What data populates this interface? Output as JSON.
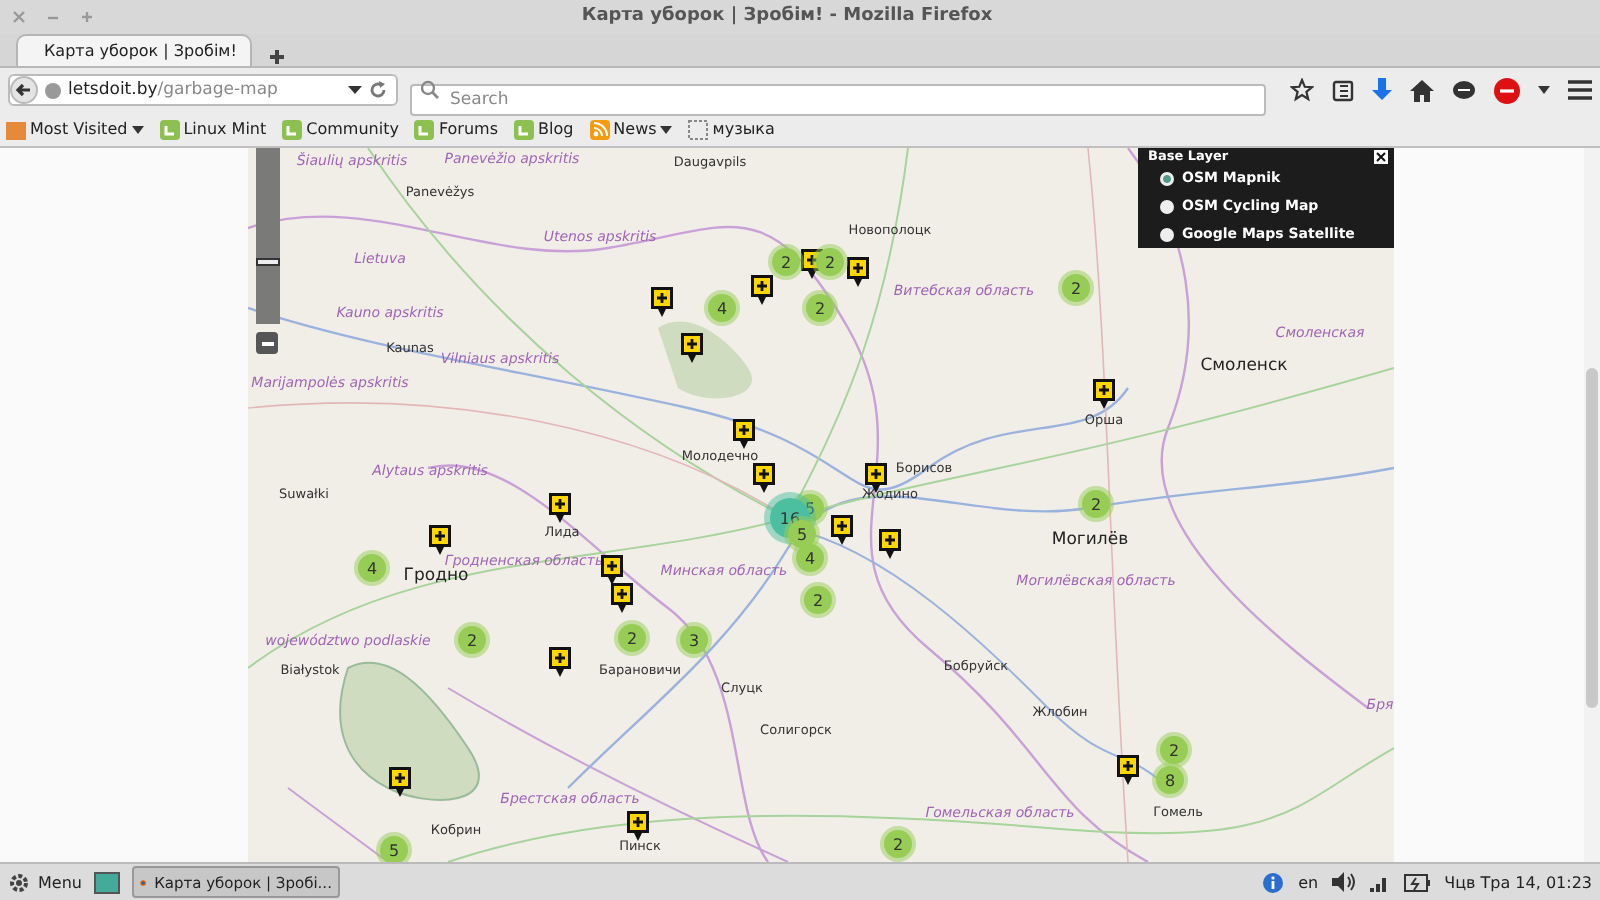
{
  "window": {
    "title": "Карта уборок | Зробім! - Mozilla Firefox"
  },
  "tabs": [
    {
      "label": "Карта уборок | Зробім!",
      "selected": true
    }
  ],
  "url": {
    "host": "letsdoit.by",
    "path": "/garbage-map"
  },
  "search": {
    "placeholder": "Search"
  },
  "bookmarks": [
    {
      "label": "Most Visited",
      "kind": "menu"
    },
    {
      "label": "Linux Mint",
      "kind": "page"
    },
    {
      "label": "Community",
      "kind": "page"
    },
    {
      "label": "Forums",
      "kind": "page"
    },
    {
      "label": "Blog",
      "kind": "page"
    },
    {
      "label": "News",
      "kind": "feed"
    },
    {
      "label": "музыка",
      "kind": "folder"
    }
  ],
  "map": {
    "zoom": {
      "level": 0.35
    },
    "layer_switcher": {
      "title": "Base Layer",
      "options": [
        {
          "label": "OSM Mapnik",
          "selected": true
        },
        {
          "label": "OSM Cycling Map",
          "selected": false
        },
        {
          "label": "Google Maps Satellite",
          "selected": false
        }
      ]
    },
    "labels": [
      {
        "text": "Šiaulių apskritis",
        "kind": "region"
      },
      {
        "text": "Panevėžio apskritis",
        "kind": "region"
      },
      {
        "text": "Daugavpils",
        "kind": "city"
      },
      {
        "text": "Panevėžys",
        "kind": "city"
      },
      {
        "text": "Utenos apskritis",
        "kind": "region"
      },
      {
        "text": "Новополоцк",
        "kind": "city"
      },
      {
        "text": "Lietuva",
        "kind": "region"
      },
      {
        "text": "Kauno apskritis",
        "kind": "region"
      },
      {
        "text": "Витебская область",
        "kind": "region"
      },
      {
        "text": "Kaunas",
        "kind": "city"
      },
      {
        "text": "Vilniaus apskritis",
        "kind": "region"
      },
      {
        "text": "Marijampolės apskritis",
        "kind": "region"
      },
      {
        "text": "Смоленская",
        "kind": "region"
      },
      {
        "text": "Смоленск",
        "kind": "capital"
      },
      {
        "text": "Молодечно",
        "kind": "city"
      },
      {
        "text": "Орша",
        "kind": "city"
      },
      {
        "text": "Alytaus apskritis",
        "kind": "region"
      },
      {
        "text": "Suwałki",
        "kind": "city"
      },
      {
        "text": "Борисов",
        "kind": "city"
      },
      {
        "text": "Жодино",
        "kind": "city"
      },
      {
        "text": "Лида",
        "kind": "city"
      },
      {
        "text": "Могилёв",
        "kind": "capital"
      },
      {
        "text": "Гродно",
        "kind": "capital"
      },
      {
        "text": "Гродненская область",
        "kind": "region"
      },
      {
        "text": "Минская область",
        "kind": "region"
      },
      {
        "text": "Могилёвская область",
        "kind": "region"
      },
      {
        "text": "województwo podlaskie",
        "kind": "region"
      },
      {
        "text": "Białystok",
        "kind": "city"
      },
      {
        "text": "Барановичи",
        "kind": "city"
      },
      {
        "text": "Бобруйск",
        "kind": "city"
      },
      {
        "text": "Слуцк",
        "kind": "city"
      },
      {
        "text": "Жлобин",
        "kind": "city"
      },
      {
        "text": "Солигорск",
        "kind": "city"
      },
      {
        "text": "Гомель",
        "kind": "city"
      },
      {
        "text": "Брестская область",
        "kind": "region"
      },
      {
        "text": "Гомельская область",
        "kind": "region"
      },
      {
        "text": "Кобрин",
        "kind": "city"
      },
      {
        "text": "Пинск",
        "kind": "city"
      },
      {
        "text": "Бря",
        "kind": "region"
      }
    ],
    "clusters": [
      {
        "count": "2",
        "kind": "small"
      },
      {
        "count": "2",
        "kind": "small"
      },
      {
        "count": "4",
        "kind": "small"
      },
      {
        "count": "2",
        "kind": "small"
      },
      {
        "count": "2",
        "kind": "small"
      },
      {
        "count": "5",
        "kind": "small"
      },
      {
        "count": "16",
        "kind": "large"
      },
      {
        "count": "5",
        "kind": "small"
      },
      {
        "count": "4",
        "kind": "small"
      },
      {
        "count": "2",
        "kind": "small"
      },
      {
        "count": "4",
        "kind": "small"
      },
      {
        "count": "2",
        "kind": "small"
      },
      {
        "count": "2",
        "kind": "small"
      },
      {
        "count": "3",
        "kind": "small"
      },
      {
        "count": "2",
        "kind": "small"
      },
      {
        "count": "2",
        "kind": "small"
      },
      {
        "count": "8",
        "kind": "small"
      },
      {
        "count": "5",
        "kind": "small"
      },
      {
        "count": "2",
        "kind": "small"
      }
    ]
  },
  "taskbar": {
    "menu": "Menu",
    "task": "Карта уборок | Зробі...",
    "language": "en",
    "clock": "Чцв Тра 14, 01:23"
  }
}
